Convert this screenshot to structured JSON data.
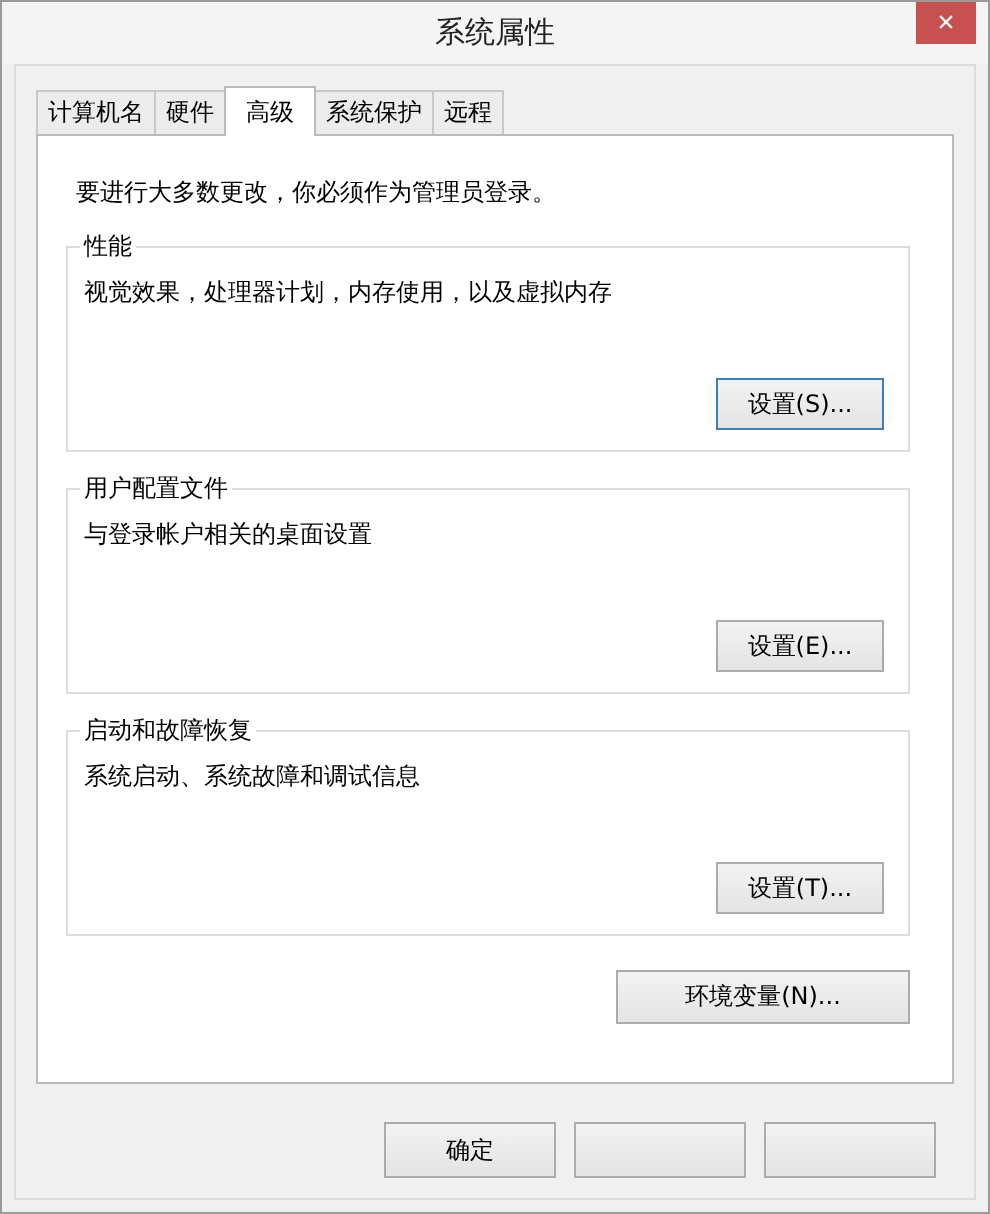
{
  "window": {
    "title": "系统属性",
    "close": "×"
  },
  "tabs": [
    {
      "label": "计算机名",
      "selected": false
    },
    {
      "label": "硬件",
      "selected": false
    },
    {
      "label": "高级",
      "selected": true
    },
    {
      "label": "系统保护",
      "selected": false
    },
    {
      "label": "远程",
      "selected": false
    }
  ],
  "notice": "要进行大多数更改，你必须作为管理员登录。",
  "groups": [
    {
      "title": "性能",
      "description": "视觉效果，处理器计划，内存使用，以及虚拟内存",
      "button": "设置(S)...",
      "focused": true
    },
    {
      "title": "用户配置文件",
      "description": "与登录帐户相关的桌面设置",
      "button": "设置(E)...",
      "focused": false
    },
    {
      "title": "启动和故障恢复",
      "description": "系统启动、系统故障和调试信息",
      "button": "设置(T)...",
      "focused": false
    }
  ],
  "env_button": "环境变量(N)...",
  "buttons": [
    {
      "kind": "button",
      "label": "确定"
    },
    {
      "kind": "button"
    },
    {
      "kind": "button"
    }
  ]
}
